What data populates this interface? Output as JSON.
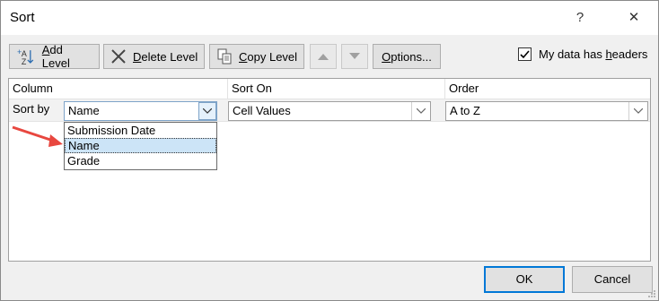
{
  "dialog": {
    "title": "Sort",
    "help_glyph": "?",
    "close_glyph": "✕"
  },
  "toolbar": {
    "add_level": {
      "label": "Add Level",
      "mnemonic": "A",
      "rest": "dd Level",
      "icon": "add-level-icon"
    },
    "delete_level": {
      "label": "Delete Level",
      "mnemonic": "D",
      "rest": "elete Level",
      "icon": "delete-x-icon"
    },
    "copy_level": {
      "label": "Copy Level",
      "mnemonic": "C",
      "rest": "opy Level",
      "icon": "copy-icon"
    },
    "move_up": {
      "icon": "arrow-up-icon"
    },
    "move_down": {
      "icon": "arrow-down-icon"
    },
    "options": {
      "label": "Options...",
      "mnemonic": "O",
      "rest": "ptions..."
    },
    "headers_checkbox": {
      "label": "My data has headers",
      "pre": "My data has ",
      "mnemonic": "h",
      "post": "eaders",
      "checked": true
    }
  },
  "grid": {
    "headers": {
      "column": "Column",
      "sort_on": "Sort On",
      "order": "Order"
    },
    "row": {
      "label": "Sort by",
      "column_value": "Name",
      "sort_on_value": "Cell Values",
      "order_value": "A to Z"
    },
    "column_dropdown_options": [
      "Submission Date",
      "Name",
      "Grade"
    ],
    "selected_option_index": 1
  },
  "footer": {
    "ok": "OK",
    "cancel": "Cancel"
  },
  "colors": {
    "accent": "#0078d7",
    "selection": "#cce4f7",
    "annotation_arrow": "#e8473f"
  }
}
